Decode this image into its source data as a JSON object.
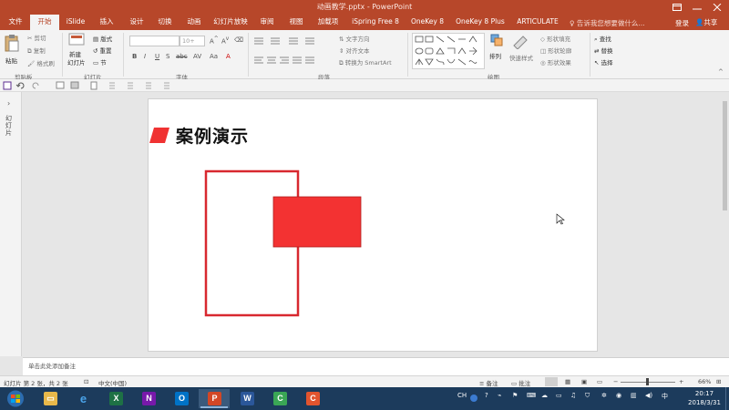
{
  "window": {
    "title": "动画教学.pptx - PowerPoint",
    "controls": [
      "minimize-icon",
      "maximize-icon",
      "close-icon"
    ]
  },
  "tabs": [
    {
      "label": "文件",
      "active": false
    },
    {
      "label": "开始",
      "active": true
    },
    {
      "label": "iSlide",
      "active": false
    },
    {
      "label": "插入",
      "active": false
    },
    {
      "label": "设计",
      "active": false
    },
    {
      "label": "切换",
      "active": false
    },
    {
      "label": "动画",
      "active": false
    },
    {
      "label": "幻灯片放映",
      "active": false
    },
    {
      "label": "审阅",
      "active": false
    },
    {
      "label": "视图",
      "active": false
    },
    {
      "label": "加载项",
      "active": false
    },
    {
      "label": "iSpring Free 8",
      "active": false
    },
    {
      "label": "OneKey 8",
      "active": false
    },
    {
      "label": "OneKey 8 Plus",
      "active": false
    },
    {
      "label": "ARTICULATE",
      "active": false
    }
  ],
  "tell_me": "告诉我您想要做什么...",
  "login": "登录",
  "share": "共享",
  "ribbon": {
    "clipboard": {
      "paste": "粘贴",
      "cut": "剪切",
      "copy": "复制",
      "format_painter": "格式刷",
      "label": "剪贴板"
    },
    "slides": {
      "new_slide": "新建",
      "new_slide2": "幻灯片",
      "layout": "版式",
      "reset": "重置",
      "section": "节",
      "label": "幻灯片"
    },
    "font": {
      "label": "字体",
      "size": "10+",
      "bold": "B",
      "italic": "I",
      "underline": "U",
      "strike": "S",
      "shadow": "abc",
      "spacing": "AV",
      "case": "Aa",
      "color": "A"
    },
    "paragraph": {
      "label": "段落",
      "text_direction": "文字方向",
      "align_text": "对齐文本",
      "smartart": "转换为 SmartArt"
    },
    "drawing": {
      "label": "绘图",
      "arrange": "排列",
      "quick_styles": "快速样式",
      "shape_fill": "形状填充",
      "shape_outline": "形状轮廓",
      "shape_effects": "形状效果"
    },
    "editing": {
      "find": "查找",
      "replace": "替换",
      "select": "选择"
    }
  },
  "left_pane": {
    "label": "幻灯片"
  },
  "slide": {
    "title": "案例演示",
    "colors": {
      "accent": "#f03232",
      "outline": "#d8282f",
      "fill": "#f33232"
    }
  },
  "notes": {
    "placeholder": "单击此处添加备注"
  },
  "status": {
    "slide_info": "幻灯片 第 2 张，共 2 张",
    "language": "中文(中国)",
    "notes": "备注",
    "comments": "批注",
    "zoom": "66%"
  },
  "taskbar": {
    "apps": [
      "start",
      "file-explorer",
      "internet-explorer",
      "excel",
      "onenote",
      "outlook",
      "powerpoint",
      "word",
      "camtasia-green",
      "camtasia-orange"
    ],
    "ch": "CH",
    "time": "20:17",
    "date": "2018/3/31"
  }
}
